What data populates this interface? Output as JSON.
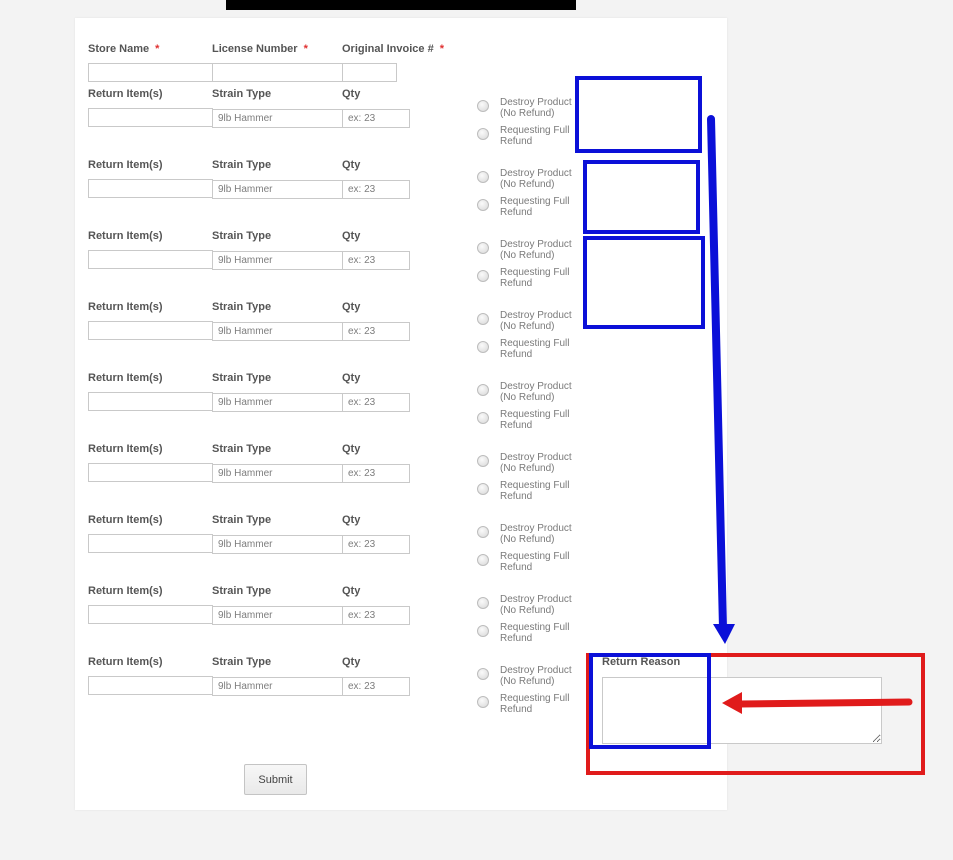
{
  "header": {
    "store_name_label": "Store Name",
    "license_number_label": "License Number",
    "original_invoice_label": "Original Invoice #",
    "required_mark": "*"
  },
  "rows": [
    {
      "return_items_label": "Return Item(s)",
      "strain_type_label": "Strain Type",
      "qty_label": "Qty",
      "strain_placeholder": "9lb Hammer",
      "qty_placeholder": "ex: 23",
      "option_destroy": [
        "Destroy Product",
        "(No Refund)"
      ],
      "option_refund": [
        "Requesting Full",
        "Refund"
      ]
    },
    {
      "return_items_label": "Return Item(s)",
      "strain_type_label": "Strain Type",
      "qty_label": "Qty",
      "strain_placeholder": "9lb Hammer",
      "qty_placeholder": "ex: 23",
      "option_destroy": [
        "Destroy Product",
        "(No Refund)"
      ],
      "option_refund": [
        "Requesting Full",
        "Refund"
      ]
    },
    {
      "return_items_label": "Return Item(s)",
      "strain_type_label": "Strain Type",
      "qty_label": "Qty",
      "strain_placeholder": "9lb Hammer",
      "qty_placeholder": "ex: 23",
      "option_destroy": [
        "Destroy Product",
        "(No Refund)"
      ],
      "option_refund": [
        "Requesting Full",
        "Refund"
      ]
    },
    {
      "return_items_label": "Return Item(s)",
      "strain_type_label": "Strain Type",
      "qty_label": "Qty",
      "strain_placeholder": "9lb Hammer",
      "qty_placeholder": "ex: 23",
      "option_destroy": [
        "Destroy Product",
        "(No Refund)"
      ],
      "option_refund": [
        "Requesting Full",
        "Refund"
      ]
    },
    {
      "return_items_label": "Return Item(s)",
      "strain_type_label": "Strain Type",
      "qty_label": "Qty",
      "strain_placeholder": "9lb Hammer",
      "qty_placeholder": "ex: 23",
      "option_destroy": [
        "Destroy Product",
        "(No Refund)"
      ],
      "option_refund": [
        "Requesting Full",
        "Refund"
      ]
    },
    {
      "return_items_label": "Return Item(s)",
      "strain_type_label": "Strain Type",
      "qty_label": "Qty",
      "strain_placeholder": "9lb Hammer",
      "qty_placeholder": "ex: 23",
      "option_destroy": [
        "Destroy Product",
        "(No Refund)"
      ],
      "option_refund": [
        "Requesting Full",
        "Refund"
      ]
    },
    {
      "return_items_label": "Return Item(s)",
      "strain_type_label": "Strain Type",
      "qty_label": "Qty",
      "strain_placeholder": "9lb Hammer",
      "qty_placeholder": "ex: 23",
      "option_destroy": [
        "Destroy Product",
        "(No Refund)"
      ],
      "option_refund": [
        "Requesting Full",
        "Refund"
      ]
    },
    {
      "return_items_label": "Return Item(s)",
      "strain_type_label": "Strain Type",
      "qty_label": "Qty",
      "strain_placeholder": "9lb Hammer",
      "qty_placeholder": "ex: 23",
      "option_destroy": [
        "Destroy Product",
        "(No Refund)"
      ],
      "option_refund": [
        "Requesting Full",
        "Refund"
      ]
    },
    {
      "return_items_label": "Return Item(s)",
      "strain_type_label": "Strain Type",
      "qty_label": "Qty",
      "strain_placeholder": "9lb Hammer",
      "qty_placeholder": "ex: 23",
      "option_destroy": [
        "Destroy Product",
        "(No Refund)"
      ],
      "option_refund": [
        "Requesting Full",
        "Refund"
      ]
    }
  ],
  "return_reason_label": "Return Reason",
  "submit_label": "Submit",
  "annotation_colors": {
    "blue": "#0b10d8",
    "red": "#e01b1b"
  }
}
